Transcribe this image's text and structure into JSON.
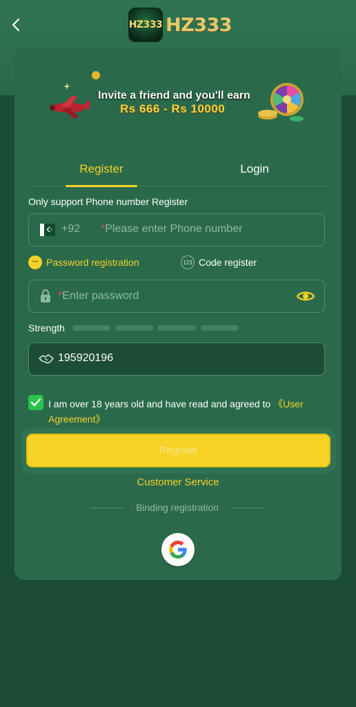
{
  "header": {
    "logo_badge_text": "HZ333",
    "logo_text": "HZ333"
  },
  "banner": {
    "line1": "Invite a friend and you'll earn",
    "line2": "Rs 666 - Rs 10000"
  },
  "tabs": [
    {
      "label": "Register",
      "active": true
    },
    {
      "label": "Login",
      "active": false
    }
  ],
  "form": {
    "support_text": "Only support Phone number Register",
    "phone": {
      "country_code": "+92",
      "required_mark": "*",
      "placeholder": "Please enter Phone number"
    },
    "modes": {
      "password_label": "Password registration",
      "password_icon_text": "***",
      "code_label": "Code register",
      "code_icon_text": "123"
    },
    "password": {
      "required_mark": "*",
      "placeholder": "Enter password"
    },
    "strength_label": "Strength",
    "invite_code": "195920196",
    "agreement": {
      "text": "I am over 18 years old and have read and agreed to ",
      "link": "《User Agreement》",
      "checked": true
    },
    "register_button": "Register",
    "customer_service": "Customer Service",
    "binding_label": "Binding registration"
  },
  "colors": {
    "accent": "#f4d227",
    "card": "#2a6a4b",
    "background": "#1c4b37",
    "check": "#2ac34a"
  }
}
